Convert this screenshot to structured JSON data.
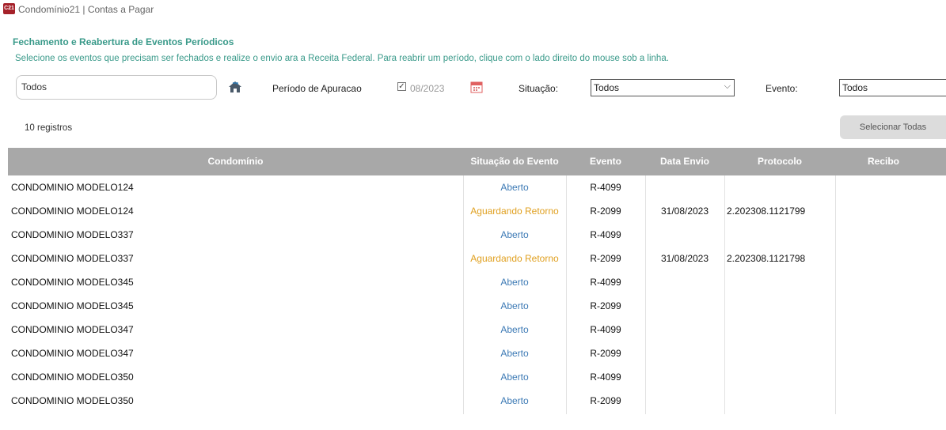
{
  "window": {
    "title": "Condomínio21 | Contas a Pagar",
    "app_icon_text": "C21"
  },
  "page": {
    "title": "Fechamento e Reabertura de Eventos Períodicos",
    "subtitle": "Selecione os eventos que precisam ser fechados e realize o envio ara a Receita Federal. Para reabrir um período, clique com o lado direito do mouse sob a linha."
  },
  "filters": {
    "search_value": "Todos",
    "period_label": "Período de Apuracao",
    "period_value": "08/2023",
    "period_checked": true,
    "situation_label": "Situação:",
    "situation_value": "Todos",
    "event_label": "Evento:",
    "event_value": "Todos"
  },
  "records_count": "10 registros",
  "select_all_label": "Selecionar Todas",
  "colors": {
    "accent": "#3a9a8a",
    "aberto": "#3d7ab5",
    "aguardando": "#e0a020",
    "header": "#a8a8a8"
  },
  "table": {
    "headers": {
      "condominio": "Condomínio",
      "situacao": "Situação do Evento",
      "evento": "Evento",
      "data_envio": "Data Envio",
      "protocolo": "Protocolo",
      "recibo": "Recibo"
    },
    "rows": [
      {
        "condominio": "CONDOMINIO MODELO124",
        "situacao": "Aberto",
        "evento": "R-4099",
        "data_envio": "",
        "protocolo": "",
        "recibo": ""
      },
      {
        "condominio": "CONDOMINIO MODELO124",
        "situacao": "Aguardando Retorno",
        "evento": "R-2099",
        "data_envio": "31/08/2023",
        "protocolo": "2.202308.1121799",
        "recibo": ""
      },
      {
        "condominio": "CONDOMINIO MODELO337",
        "situacao": "Aberto",
        "evento": "R-4099",
        "data_envio": "",
        "protocolo": "",
        "recibo": ""
      },
      {
        "condominio": "CONDOMINIO MODELO337",
        "situacao": "Aguardando Retorno",
        "evento": "R-2099",
        "data_envio": "31/08/2023",
        "protocolo": "2.202308.1121798",
        "recibo": ""
      },
      {
        "condominio": "CONDOMINIO MODELO345",
        "situacao": "Aberto",
        "evento": "R-4099",
        "data_envio": "",
        "protocolo": "",
        "recibo": ""
      },
      {
        "condominio": "CONDOMINIO MODELO345",
        "situacao": "Aberto",
        "evento": "R-2099",
        "data_envio": "",
        "protocolo": "",
        "recibo": ""
      },
      {
        "condominio": "CONDOMINIO MODELO347",
        "situacao": "Aberto",
        "evento": "R-4099",
        "data_envio": "",
        "protocolo": "",
        "recibo": ""
      },
      {
        "condominio": "CONDOMINIO MODELO347",
        "situacao": "Aberto",
        "evento": "R-2099",
        "data_envio": "",
        "protocolo": "",
        "recibo": ""
      },
      {
        "condominio": "CONDOMINIO MODELO350",
        "situacao": "Aberto",
        "evento": "R-4099",
        "data_envio": "",
        "protocolo": "",
        "recibo": ""
      },
      {
        "condominio": "CONDOMINIO MODELO350",
        "situacao": "Aberto",
        "evento": "R-2099",
        "data_envio": "",
        "protocolo": "",
        "recibo": ""
      }
    ]
  }
}
